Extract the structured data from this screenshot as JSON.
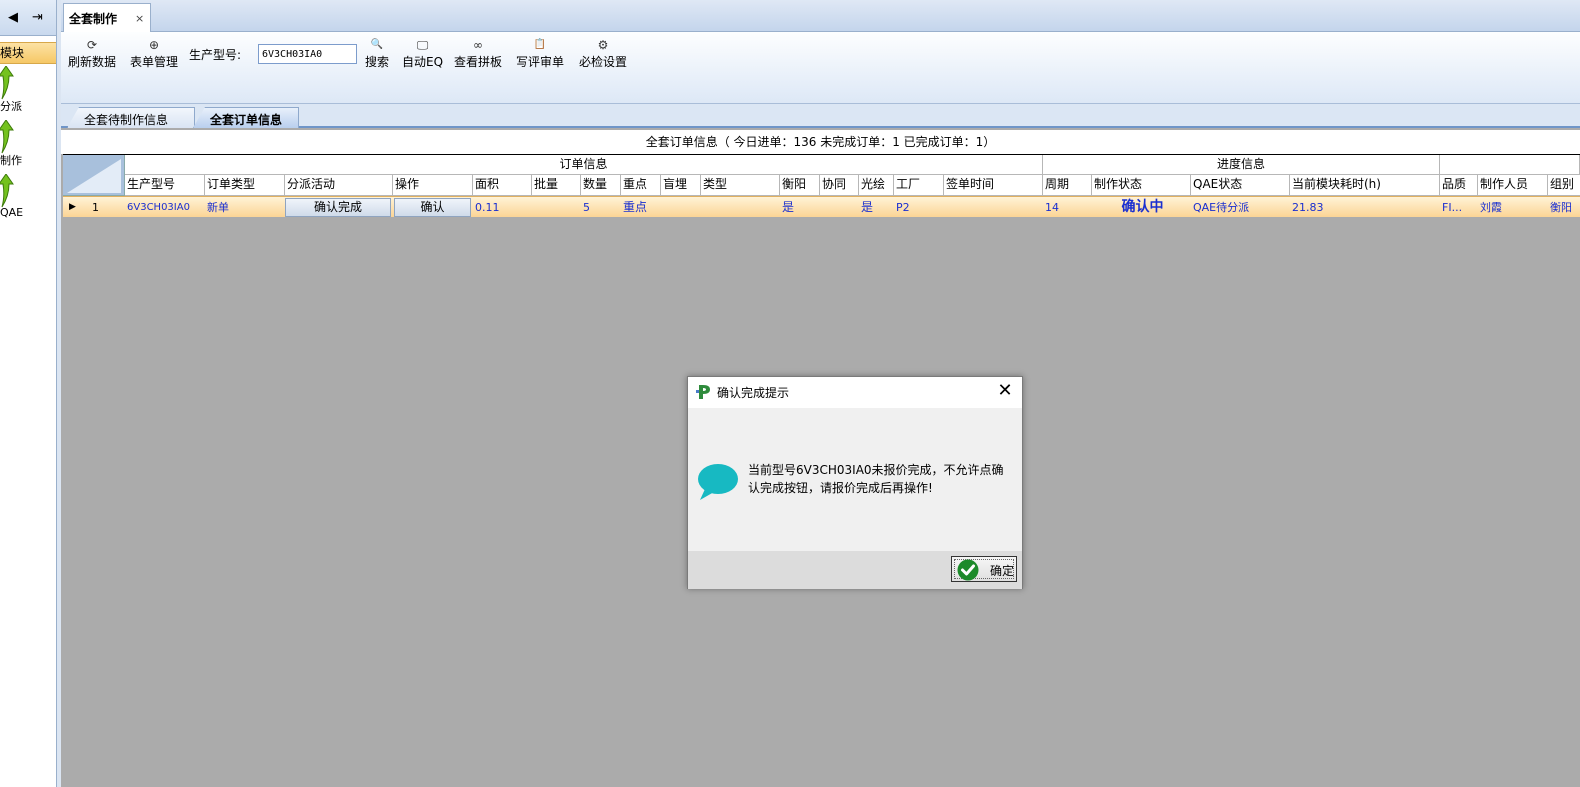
{
  "leftnav": {
    "back_glyph": "◀",
    "login_glyph": "⇥",
    "module_header": "模块",
    "items": [
      {
        "label": "分派",
        "icon": "green-arrow-icon"
      },
      {
        "label": "制作",
        "icon": "green-arrow-icon"
      },
      {
        "label": "QAE",
        "icon": "green-arrow-icon"
      }
    ]
  },
  "tab": {
    "title": "全套制作",
    "close": "×"
  },
  "toolbar": {
    "refresh": {
      "label": "刷新数据",
      "icon": "refresh-icon",
      "glyph": "⟳"
    },
    "forms": {
      "label": "表单管理",
      "icon": "plus-circle-icon",
      "glyph": "⊕"
    },
    "product_label": "生产型号:",
    "product_value": "6V3CH03IA0",
    "search": {
      "label": "搜索",
      "icon": "search-icon",
      "glyph": "🔍"
    },
    "auto_eq": {
      "label": "自动EQ",
      "icon": "monitor-icon",
      "glyph": "🖵"
    },
    "panel": {
      "label": "查看拼板",
      "icon": "link-icon",
      "glyph": "∞"
    },
    "review": {
      "label": "写评审单",
      "icon": "clipboard-icon",
      "glyph": "📋"
    },
    "settings": {
      "label": "必检设置",
      "icon": "gears-icon",
      "glyph": "⚙"
    }
  },
  "subtabs": {
    "tab1": "全套待制作信息",
    "tab2": "全套订单信息"
  },
  "summary": "全套订单信息（ 今日进单：136 未完成订单：1 已完成订单：1）",
  "grid": {
    "group_order": "订单信息",
    "group_progress": "进度信息",
    "columns": [
      "生产型号",
      "订单类型",
      "分派活动",
      "操作",
      "面积",
      "批量",
      "数量",
      "重点",
      "盲埋",
      "类型",
      "衡阳",
      "协同",
      "光绘",
      "工厂",
      "签单时间",
      "周期",
      "制作状态",
      "QAE状态",
      "当前模块耗时(h)",
      "品质",
      "制作人员",
      "组别"
    ],
    "row": {
      "index": "1",
      "product": "6V3CH03IA0",
      "order_type": "新单",
      "assign_btn": "确认完成",
      "op_btn": "确认",
      "area": "0.11",
      "batch": "",
      "qty": "5",
      "key": "重点",
      "blind": "",
      "type": "",
      "hengyang": "是",
      "coop": "",
      "photo": "是",
      "factory": "P2",
      "sign_time": "",
      "cycle": "14",
      "status": "确认中",
      "qae_status": "QAE待分派",
      "elapsed": "21.83",
      "quality": "FI...",
      "maker": "刘霞",
      "group": "衡阳"
    }
  },
  "dialog": {
    "title": "确认完成提示",
    "close": "✕",
    "message": "当前型号6V3CH03IA0未报价完成，不允许点确认完成按钮，请报价完成后再操作!",
    "ok_label": "确定"
  },
  "colors": {
    "accent_blue": "#1a2fd0",
    "row_highlight": "#fbd495",
    "chat_icon": "#17b9c2"
  }
}
